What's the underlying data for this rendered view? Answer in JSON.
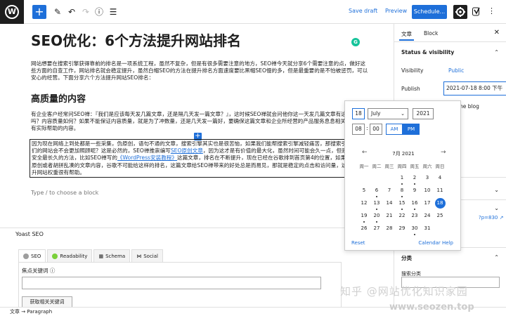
{
  "toolbar": {
    "save_draft": "Save draft",
    "preview": "Preview",
    "schedule": "Schedule...",
    "icons": [
      "wordpress-icon",
      "add-block-icon",
      "edit-pencil-icon",
      "undo-icon",
      "redo-icon",
      "details-info-icon",
      "list-view-icon",
      "settings-gear-icon",
      "yoast-icon",
      "more-options-icon"
    ],
    "colors": {
      "accent": "#1e6fd9",
      "dark": "#1e1e1e"
    }
  },
  "editor": {
    "title": "SEO优化：6个方法提升网站排名",
    "intro": "网站想要在搜索引擎获得靠前的排名是一项系统工程，虽然不复杂，但是有很多需要注意的地方，SEO禅今天就分享6个需要注意的点，做好这些方面的自查工作，网站排名就会稳定提升，虽然白帽SEO的方法在提升排名方面速度要比黑帽SEO慢的多，但是最重要的是不怕被惩罚，可以安心的经营。下面分享六个方法提升网站SEO排名：",
    "heading": "高质量的内容",
    "p2": "有企业客户经常问SEO禅：『我们是应该每天发几篇文章，还是隔几天发一篇文章？』，这时候SEO禅就会问他你这一天发几篇文章有这个精力吗？内容质量如何？如果不能保证内容质量，就是为了冲数量，还是几天发一篇好，要确保这篇文章和企业所经营的产品服务息息相关，对客户有实际帮助的内容。",
    "p3_a": "因为现在网络上到处都是一些采集，伪原创，语句不通的文章，搜索引擎其实也是很苦恼，如果我们能帮搜索引擎减轻痛苦，那搜索引擎对我们的网站会不会更加照顾呢？这是必然的，SEO禅推崇编写",
    "p3_link1": "SEO原创文章",
    "p3_b": "，因为这才是有价值的最大化，虽然时间可能会久一点，但是也是最安全最长久的方法，比如SEO禅写的",
    "p3_link2": "《WordPress安装教程》",
    "p3_c": "这篇文章，排名在不断提升，现在已经在谷歌排到首页第4的位置，如果是一篇伪原创或者胡拼乱凑的文章内容，谷歌不可能给这样的排名，这篇文章给SEO禅带来的好处总是而易见，那就是稳定的点击和访问量，这对于提升网站权重很有帮助。",
    "appender": "Type / to choose a block",
    "grammarly_letter": "G"
  },
  "yoast": {
    "title": "Yoast SEO",
    "tabs": [
      {
        "label": "SEO",
        "dot": "#9e9e9e"
      },
      {
        "label": "Readability",
        "dot": "#7ad03a"
      },
      {
        "label": "Schema",
        "dot": ""
      },
      {
        "label": "Social",
        "dot": ""
      }
    ],
    "focus_keyphrase_label": "焦点关键词",
    "related_btn": "获取相关关键词"
  },
  "breadcrumb": "文章  →  Paragraph",
  "sidebar": {
    "tab_post": "文章",
    "tab_block": "Block",
    "status_visibility": "Status & visibility",
    "visibility_label": "Visibility",
    "visibility_value": "Public",
    "publish_label": "Publish",
    "publish_value": "2021-07-18 8:00 下午",
    "blog_text": "the blog",
    "permalink_text": "?p=830 ↗",
    "category_section": "分类",
    "category_search": "搜索分类"
  },
  "picker": {
    "day": "18",
    "month": "July",
    "year": "2021",
    "hour": "08",
    "minute": "00",
    "am": "AM",
    "pm": "PM",
    "caption": "7月 2021",
    "weekdays": [
      "周一",
      "周二",
      "周三",
      "周四",
      "周五",
      "周六",
      "周日"
    ],
    "weeks": [
      [
        "",
        "",
        "",
        "1",
        "2",
        "3",
        "4"
      ],
      [
        "5",
        "6",
        "7",
        "8",
        "9",
        "10",
        "11"
      ],
      [
        "12",
        "13",
        "14",
        "15",
        "16",
        "17",
        "18"
      ],
      [
        "19",
        "20",
        "21",
        "22",
        "23",
        "24",
        "25"
      ],
      [
        "26",
        "27",
        "28",
        "29",
        "30",
        "31",
        ""
      ]
    ],
    "selected": "18",
    "event_days": [
      "1",
      "2",
      "6",
      "8",
      "13",
      "15",
      "16",
      "19",
      "20",
      "30"
    ],
    "reset": "Reset",
    "help": "Calendar Help"
  },
  "watermark": {
    "zhihu": "知乎 @网站优化知识家园",
    "url": "www.seozen.top"
  }
}
